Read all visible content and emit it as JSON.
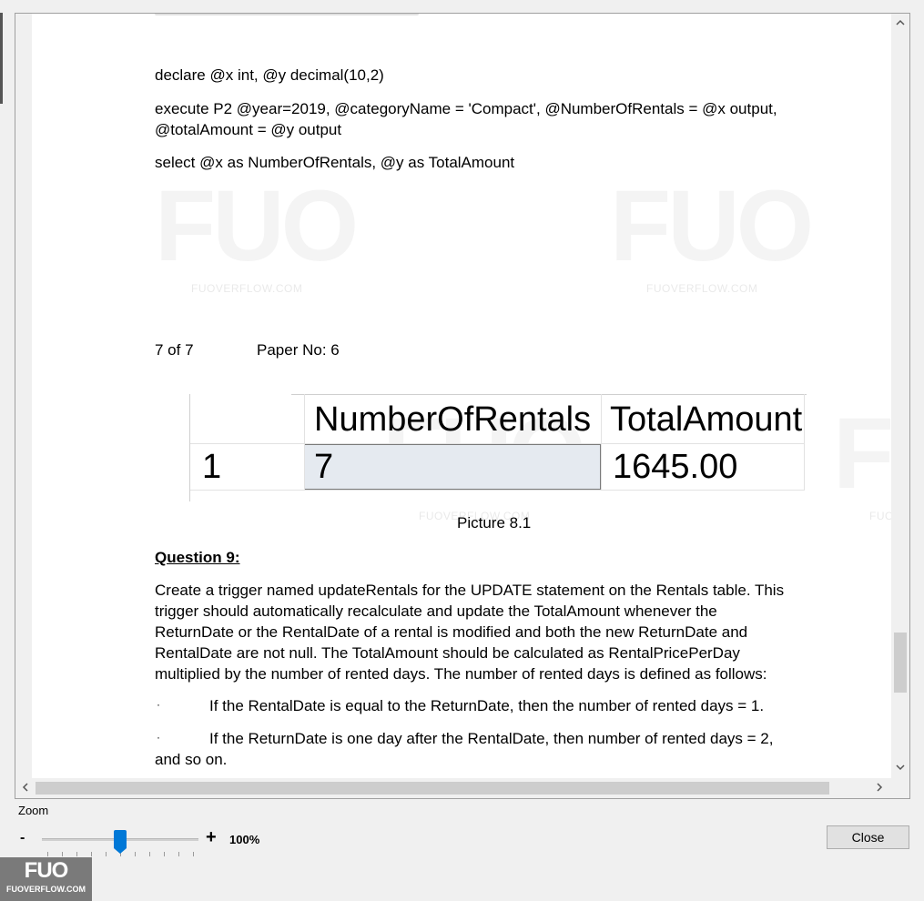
{
  "document": {
    "code_line1": "declare @x int, @y decimal(10,2)",
    "code_line2a": "execute P2 @year=2019, @categoryName = 'Compact', @NumberOfRentals = @x output,",
    "code_line2b": "@totalAmount = @y output",
    "code_line3": "select @x as NumberOfRentals, @y as TotalAmount",
    "page_number": "7 of 7",
    "paper_no": "Paper No: 6",
    "result_table": {
      "columns": [
        "NumberOfRentals",
        "TotalAmount"
      ],
      "row_number": "1",
      "row_values": [
        "7",
        "1645.00"
      ]
    },
    "caption": "Picture 8.1",
    "question_title": "Question 9:",
    "question_lines": [
      "Create a trigger named updateRentals for the UPDATE statement on the Rentals table. This",
      "trigger should automatically recalculate and update the TotalAmount whenever the",
      "ReturnDate or the RentalDate of a rental is modified and both the new ReturnDate and",
      "RentalDate are not null. The TotalAmount should be calculated as RentalPricePerDay",
      "multiplied by the number of rented days. The number of rented days is defined as follows:"
    ],
    "bullet1": "If the RentalDate is equal to the ReturnDate, then the number of rented days = 1.",
    "bullet2a": "If the ReturnDate is one day after the RentalDate, then number of rented days = 2,",
    "bullet2b": "and so on.",
    "bullet_mark": "·",
    "watermark_text": "FUO",
    "watermark_site": "FUOVERFLOW.COM"
  },
  "controls": {
    "zoom_label": "Zoom",
    "zoom_minus": "-",
    "zoom_plus": "+",
    "zoom_value": "100%",
    "zoom_level_percent": 100,
    "close_label": "Close"
  },
  "icons": {
    "scroll_up": "chevron-up-icon",
    "scroll_down": "chevron-down-icon",
    "scroll_left": "chevron-left-icon",
    "scroll_right": "chevron-right-icon"
  },
  "logo": {
    "text": "FUO",
    "site": "FUOVERFLOW.COM"
  },
  "colors": {
    "accent": "#0078d7",
    "selected_cell": "#e5eaf0"
  }
}
